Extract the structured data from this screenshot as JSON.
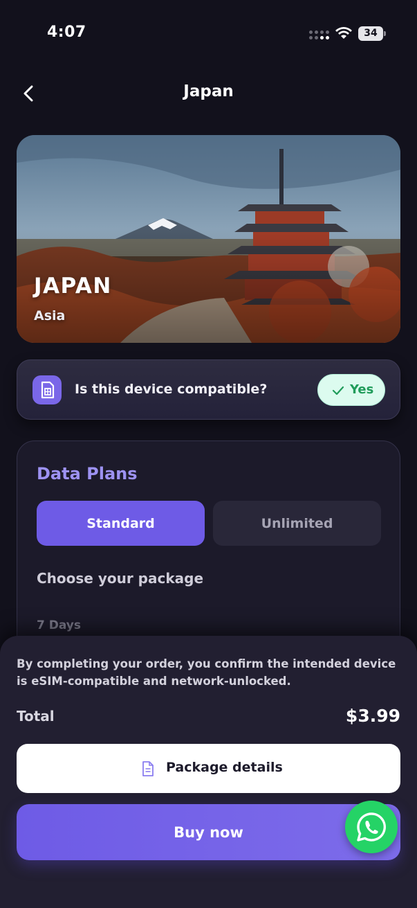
{
  "status_bar": {
    "time": "4:07",
    "battery": "34",
    "icons": [
      "signal-dots-icon",
      "wifi-icon",
      "battery-icon"
    ]
  },
  "nav": {
    "back_icon": "chevron-left-icon",
    "title": "Japan"
  },
  "hero": {
    "title": "JAPAN",
    "subtitle": "Asia"
  },
  "compatibility": {
    "icon": "sim-card-icon",
    "question": "Is this device compatible?",
    "answer": "Yes",
    "answer_icon": "checkmark-icon",
    "colors": {
      "answer_bg": "#dcfbef",
      "answer_text": "#1f9c5a"
    }
  },
  "plans": {
    "heading": "Data Plans",
    "tabs": [
      {
        "label": "Standard",
        "selected": true
      },
      {
        "label": "Unlimited",
        "selected": false
      }
    ],
    "choose_label": "Choose your package",
    "section_label": "7 Days"
  },
  "checkout": {
    "disclaimer": "By completing your order, you confirm the intended device is eSIM-compatible and network-unlocked.",
    "total_label": "Total",
    "total_value": "$3.99",
    "details_button": "Package details",
    "details_icon": "document-icon",
    "buy_button": "Buy now"
  },
  "whatsapp": {
    "icon": "whatsapp-icon"
  },
  "colors": {
    "background": "#12111c",
    "accent": "#6e5be6",
    "heading_accent": "#9d92f2",
    "whatsapp": "#25d366"
  }
}
